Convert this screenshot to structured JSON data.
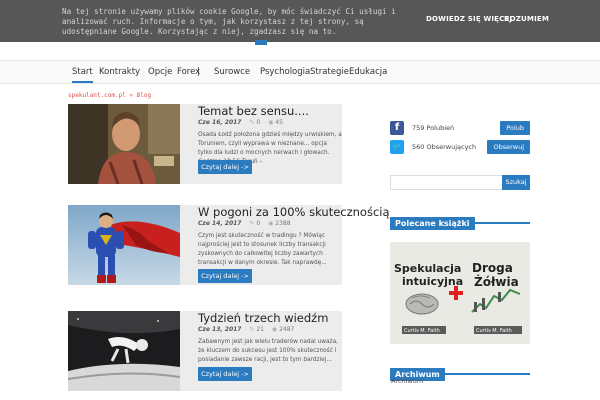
{
  "cookie_banner": {
    "text": "Na tej stronie używamy plików cookie Google, by móc świadczyć Ci usługi i analizować ruch. Informacje o tym, jak korzystasz z tej strony, są udostępniane Google. Korzystając z niej, zgadzasz się na to.",
    "learn_more_label": "DOWIEDZ SIĘ WIĘCEJ",
    "accept_label": "ROZUMIEM"
  },
  "nav": {
    "items": [
      "Start",
      "Kontrakty",
      "Opcje",
      "Forex",
      "Surowce",
      "Psychologia",
      "Strategie",
      "Edukacja"
    ],
    "active": "Start"
  },
  "breadcrumb": {
    "site": "spekulant.com.pl",
    "separator": "»",
    "current": "Blog"
  },
  "posts": [
    {
      "title": "Temat bez sensu....",
      "date": "Cze 16, 2017",
      "comments": "0",
      "views": "45",
      "excerpt": "Osada Łodź położona gdzieś między urwiskiem, a Toruniem, czyli wyprawa w nieznane... opcja tylko dla ludzi o mocnych nerwach i głowach. Godzina 18.56 Toruń –",
      "read_more": "Czytaj dalej ->"
    },
    {
      "title": "W pogoni za 100% skutecznością",
      "date": "Cze 14, 2017",
      "comments": "0",
      "views": "2388",
      "excerpt": "Czym jest skuteczność w tradingu ? Mówiąc najprościej jest to stosunek liczby transakcji zyskownych do całkowitej liczby zawartych transakcji w danym okresie. Tak naprawdę...",
      "read_more": "Czytaj dalej ->"
    },
    {
      "title": "Tydzień trzech wiedźm",
      "date": "Cze 13, 2017",
      "comments": "21",
      "views": "2487",
      "excerpt": "Zabawnym jest jak wielu traderów nadal uważa, że kluczem do sukcesu jest 100% skuteczność i posiadanie zawsze racji, jest to tym bardziej...",
      "read_more": "Czytaj dalej ->"
    }
  ],
  "sidebar": {
    "facebook": {
      "count_text": "759 Polubień",
      "button": "Polub"
    },
    "twitter": {
      "count_text": "560 Obserwujących",
      "button": "Obserwuj"
    },
    "search_button": "Szukaj",
    "books_title": "Polecane książki",
    "book1": {
      "title_line1": "Spekulacja",
      "title_line2": "intuicyjna",
      "author": "Curtis M. Faith"
    },
    "book2": {
      "title_line1": "Droga",
      "title_line2": "Żółwia",
      "author": "Curtis M. Faith"
    },
    "archive_title": "Archiwum",
    "archive_link": "Archiwum"
  },
  "colors": {
    "accent": "#2a7bc0",
    "banner": "#575757",
    "facebook": "#3b5998",
    "twitter": "#1da1f2"
  }
}
